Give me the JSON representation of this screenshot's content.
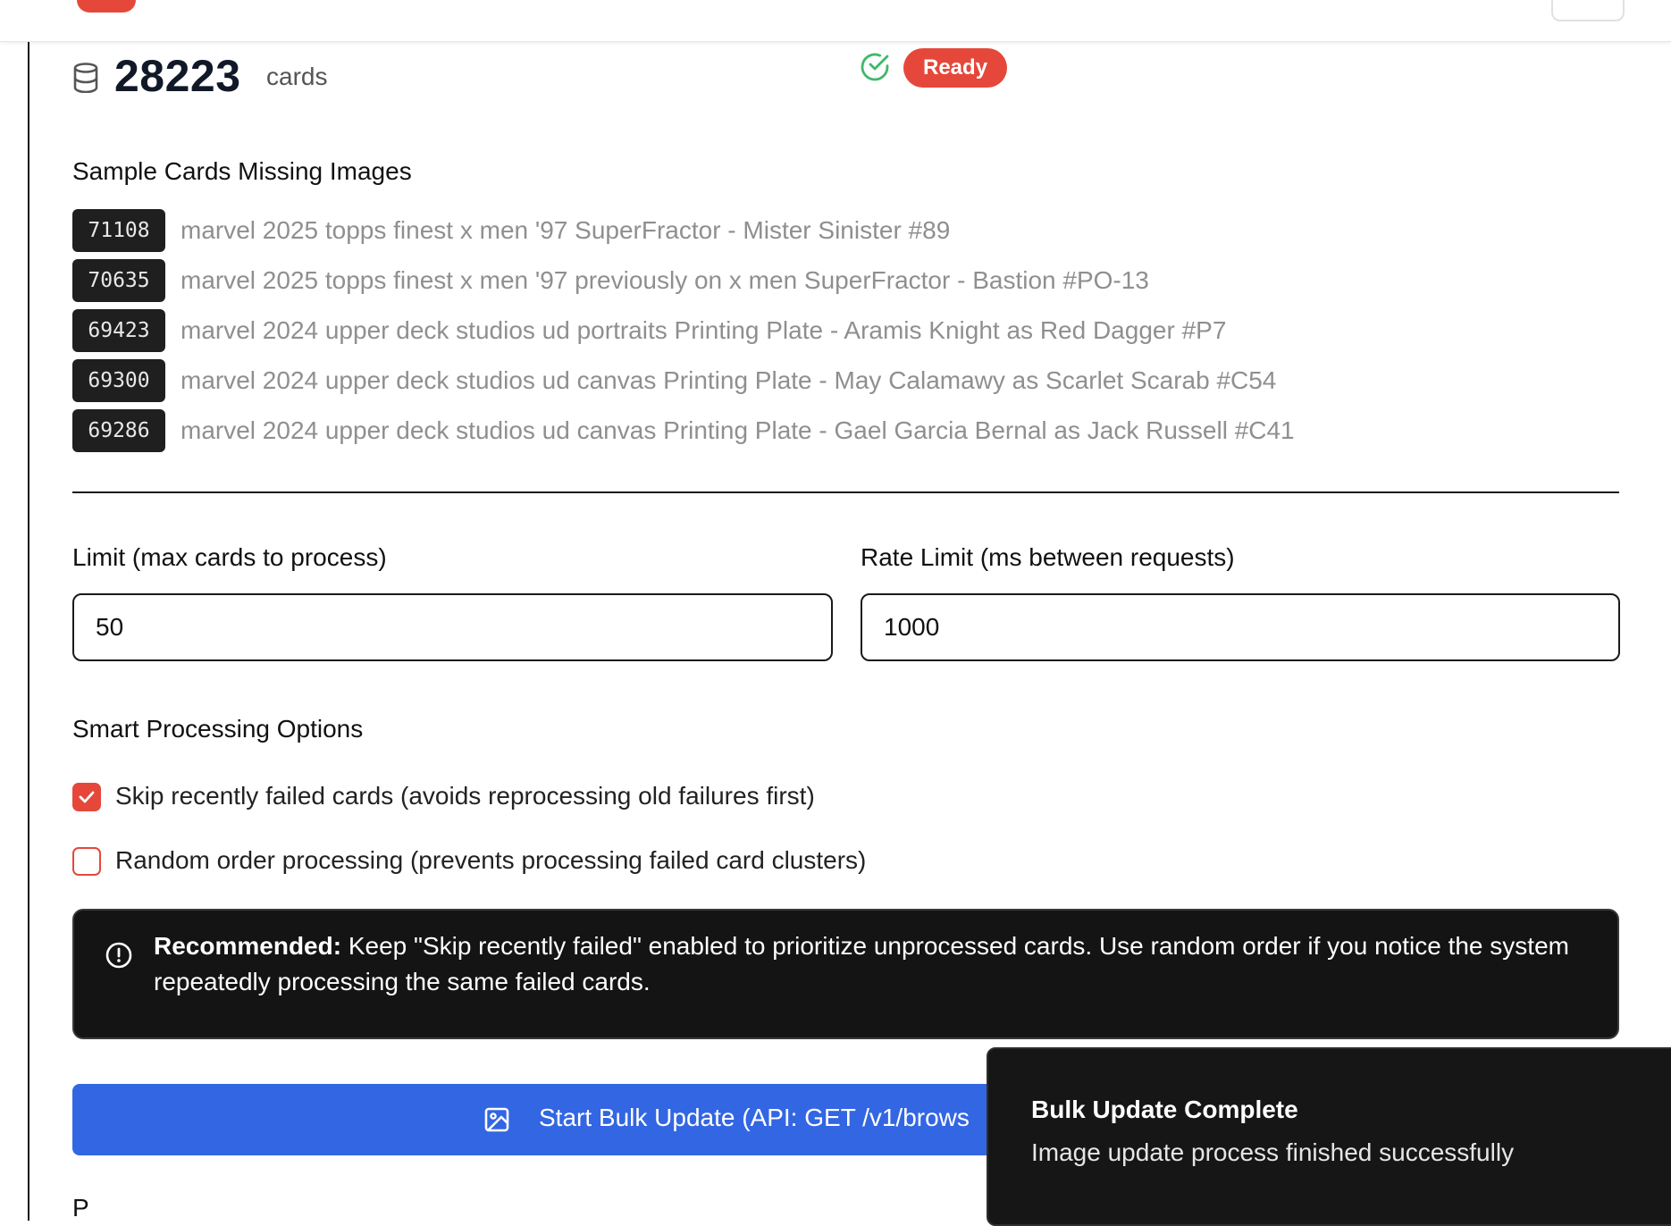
{
  "stats": {
    "count": "28223",
    "unit": "cards",
    "status": "Ready"
  },
  "sample": {
    "title": "Sample Cards Missing Images",
    "cards": [
      {
        "id": "71108",
        "name": "marvel 2025 topps finest x men '97 SuperFractor - Mister Sinister #89"
      },
      {
        "id": "70635",
        "name": "marvel 2025 topps finest x men '97 previously on x men SuperFractor - Bastion #PO-13"
      },
      {
        "id": "69423",
        "name": "marvel 2024 upper deck studios ud portraits Printing Plate - Aramis Knight as Red Dagger #P7"
      },
      {
        "id": "69300",
        "name": "marvel 2024 upper deck studios ud canvas Printing Plate - May Calamawy as Scarlet Scarab #C54"
      },
      {
        "id": "69286",
        "name": "marvel 2024 upper deck studios ud canvas Printing Plate - Gael Garcia Bernal as Jack Russell #C41"
      }
    ]
  },
  "form": {
    "limit_label": "Limit (max cards to process)",
    "limit_value": "50",
    "rate_label": "Rate Limit (ms between requests)",
    "rate_value": "1000"
  },
  "options": {
    "title": "Smart Processing Options",
    "skip_failed": {
      "label": "Skip recently failed cards (avoids reprocessing old failures first)",
      "checked": true
    },
    "random_order": {
      "label": "Random order processing (prevents processing failed card clusters)",
      "checked": false
    }
  },
  "alert": {
    "strong": "Recommended:",
    "text": " Keep \"Skip recently failed\" enabled to prioritize unprocessed cards. Use random order if you notice the system repeatedly processing the same failed cards."
  },
  "start_button": {
    "label": "Start Bulk Update (API: GET /v1/brows"
  },
  "toast": {
    "title": "Bulk Update Complete",
    "description": "Image update process finished successfully"
  },
  "colors": {
    "accent": "#e5483a",
    "primary_button": "#3366e3",
    "success": "#3fb86a"
  },
  "icons": [
    "database-icon",
    "check-circle-icon",
    "info-icon",
    "image-icon",
    "checkmark-icon"
  ]
}
